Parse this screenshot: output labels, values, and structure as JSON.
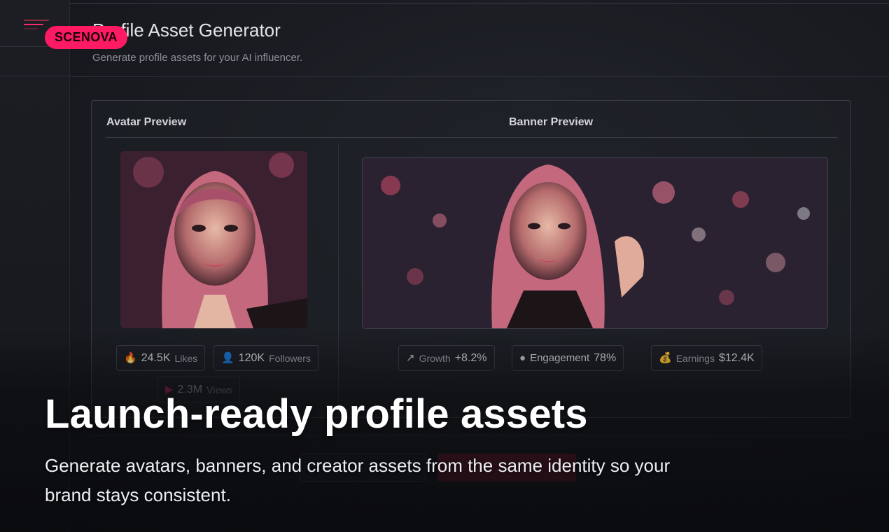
{
  "brand": {
    "badge": "SCENOVA"
  },
  "header": {
    "title": "Profile Asset Generator",
    "subtitle": "Generate profile assets for your AI influencer."
  },
  "panel": {
    "avatar_label": "Avatar Preview",
    "banner_label": "Banner Preview"
  },
  "avatar_stats": [
    {
      "icon": "flame-icon",
      "value": "24.5K",
      "label": "Likes"
    },
    {
      "icon": "user-icon",
      "value": "120K",
      "label": "Followers"
    },
    {
      "icon": "play-icon",
      "value": "2.3M",
      "label": "Views"
    }
  ],
  "banner_stats": [
    {
      "icon": "trend-up-icon",
      "label": "Growth",
      "value": "+8.2%"
    },
    {
      "icon": "circle-icon",
      "label": "Engagement",
      "value": "78%"
    },
    {
      "icon": "money-bag-icon",
      "label": "Earnings",
      "value": "$12.4K"
    }
  ],
  "hero": {
    "title": "Launch-ready profile assets",
    "subtitle": "Generate avatars, banners, and creator assets from the same identity so your brand stays consistent."
  },
  "colors": {
    "accent": "#ff1a64",
    "background": "#16181d",
    "panel_border": "#3a3d45"
  }
}
